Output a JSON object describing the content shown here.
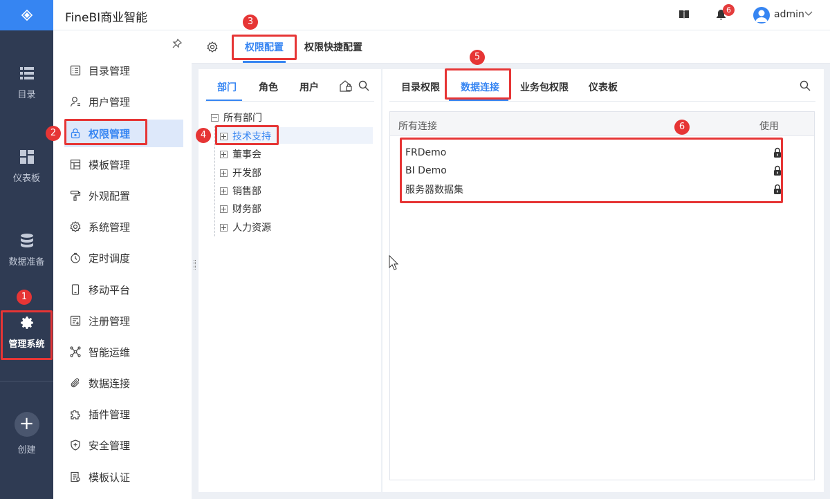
{
  "app": {
    "title": "FineBI商业智能",
    "user": "admin",
    "notification_count": "6"
  },
  "rail": {
    "items": [
      {
        "label": "目录",
        "icon": "list-icon"
      },
      {
        "label": "仪表板",
        "icon": "dashboard-icon"
      },
      {
        "label": "数据准备",
        "icon": "database-icon"
      },
      {
        "label": "管理系统",
        "icon": "gear-icon"
      }
    ],
    "create_label": "创建"
  },
  "submenu": {
    "items": [
      {
        "label": "目录管理",
        "icon": "catalog-icon"
      },
      {
        "label": "用户管理",
        "icon": "user-icon"
      },
      {
        "label": "权限管理",
        "icon": "lock-icon"
      },
      {
        "label": "模板管理",
        "icon": "template-icon"
      },
      {
        "label": "外观配置",
        "icon": "brush-icon"
      },
      {
        "label": "系统管理",
        "icon": "gear-icon"
      },
      {
        "label": "定时调度",
        "icon": "timer-icon"
      },
      {
        "label": "移动平台",
        "icon": "mobile-icon"
      },
      {
        "label": "注册管理",
        "icon": "register-icon"
      },
      {
        "label": "智能运维",
        "icon": "network-icon"
      },
      {
        "label": "数据连接",
        "icon": "paperclip-icon"
      },
      {
        "label": "插件管理",
        "icon": "puzzle-icon"
      },
      {
        "label": "安全管理",
        "icon": "shield-icon"
      },
      {
        "label": "模板认证",
        "icon": "certificate-icon"
      }
    ],
    "active_index": 2
  },
  "tabs": {
    "items": [
      "权限配置",
      "权限快捷配置"
    ],
    "active": 0
  },
  "left_panel": {
    "tabs": [
      "部门",
      "角色",
      "用户"
    ],
    "active_tab": 0,
    "tree_root": "所有部门",
    "departments": [
      "技术支持",
      "董事会",
      "开发部",
      "销售部",
      "财务部",
      "人力资源"
    ],
    "selected": 0
  },
  "right_panel": {
    "tabs": [
      "目录权限",
      "数据连接",
      "业务包权限",
      "仪表板"
    ],
    "active_tab": 1,
    "col_name": "所有连接",
    "col_use": "使用",
    "connections": [
      "FRDemo",
      "BI Demo",
      "服务器数据集"
    ]
  },
  "annotations": [
    "1",
    "2",
    "3",
    "4",
    "5",
    "6"
  ],
  "colors": {
    "accent": "#3685f2",
    "rail": "#2f3b53",
    "highlight": "#e63535"
  }
}
